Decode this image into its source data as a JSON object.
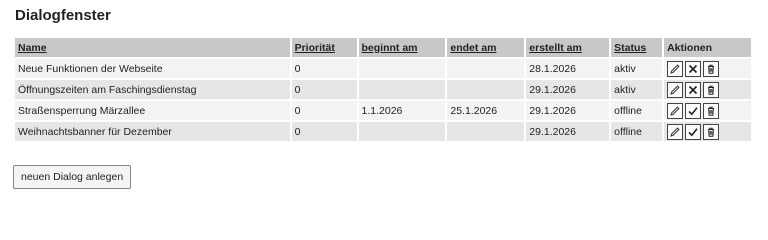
{
  "title": "Dialogfenster",
  "columns": [
    {
      "label": "Name",
      "sortable": true
    },
    {
      "label": "Priorität",
      "sortable": true
    },
    {
      "label": "beginnt am",
      "sortable": true
    },
    {
      "label": "endet am",
      "sortable": true
    },
    {
      "label": "erstellt am",
      "sortable": true
    },
    {
      "label": "Status",
      "sortable": true
    },
    {
      "label": "Aktionen",
      "sortable": false
    }
  ],
  "rows": [
    {
      "name": "Neue Funktionen der Webseite",
      "priority": "0",
      "start": "",
      "end": "",
      "created": "28.1.2026",
      "status": "aktiv",
      "toggle_icon": "close-icon"
    },
    {
      "name": "Öffnungszeiten am Faschingsdienstag",
      "priority": "0",
      "start": "",
      "end": "",
      "created": "29.1.2026",
      "status": "aktiv",
      "toggle_icon": "close-icon"
    },
    {
      "name": "Straßensperrung Märzallee",
      "priority": "0",
      "start": "1.1.2026",
      "end": "25.1.2026",
      "created": "29.1.2026",
      "status": "offline",
      "toggle_icon": "check-icon"
    },
    {
      "name": "Weihnachtsbanner für Dezember",
      "priority": "0",
      "start": "",
      "end": "",
      "created": "29.1.2026",
      "status": "offline",
      "toggle_icon": "check-icon"
    }
  ],
  "new_dialog_label": "neuen Dialog anlegen"
}
